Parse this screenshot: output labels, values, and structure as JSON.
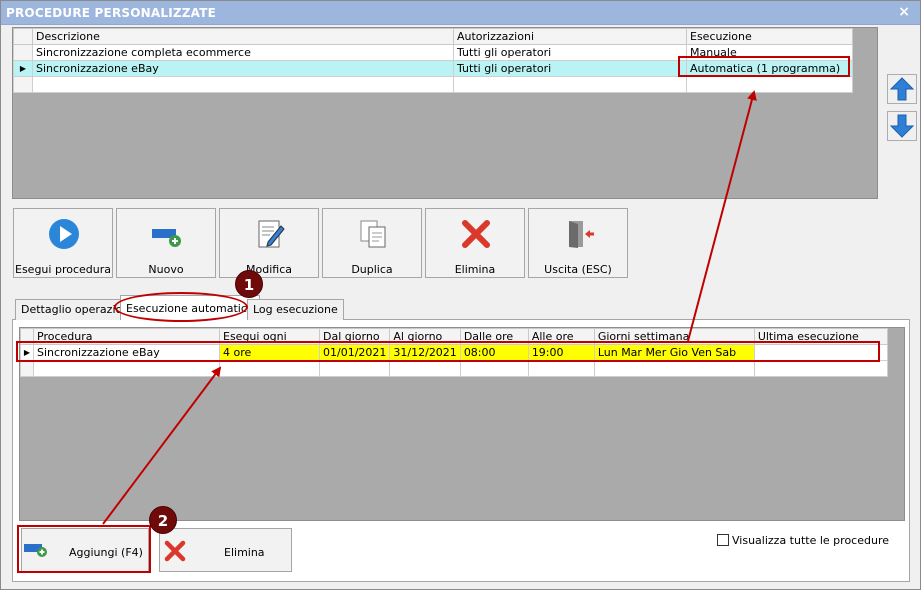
{
  "window": {
    "title": "PROCEDURE PERSONALIZZATE",
    "close_label": "×"
  },
  "procedures_grid": {
    "columns": [
      "Descrizione",
      "Autorizzazioni",
      "Esecuzione"
    ],
    "rows": [
      [
        "Sincronizzazione completa ecommerce",
        "Tutti gli operatori",
        "Manuale"
      ],
      [
        "Sincronizzazione eBay",
        "Tutti gli operatori",
        "Automatica (1 programma)"
      ]
    ]
  },
  "toolbar": {
    "run": "Esegui procedura",
    "new": "Nuovo",
    "edit": "Modifica",
    "duplicate": "Duplica",
    "delete": "Elimina",
    "exit": "Uscita (ESC)"
  },
  "tabs": [
    "Dettaglio operazioni",
    "Esecuzione automatica",
    "Log esecuzione"
  ],
  "schedule_grid": {
    "columns": [
      "Procedura",
      "Esegui ogni",
      "Dal giorno",
      "Al giorno",
      "Dalle ore",
      "Alle ore",
      "Giorni settimana",
      "Ultima esecuzione"
    ],
    "rows": [
      [
        "Sincronizzazione eBay",
        "4 ore",
        "01/01/2021",
        "31/12/2021",
        "08:00",
        "19:00",
        "Lun Mar Mer Gio Ven Sab",
        ""
      ]
    ]
  },
  "bottom": {
    "add": "Aggiungi (F4)",
    "delete": "Elimina",
    "show_all": "Visualizza tutte le procedure"
  },
  "annotations": {
    "badge1": "1",
    "badge2": "2"
  },
  "colors": {
    "highlight": "#c00000",
    "selected_row": "#b9f3f3",
    "schedule_row": "#ffff00",
    "titlebar": "#9db6dd"
  }
}
